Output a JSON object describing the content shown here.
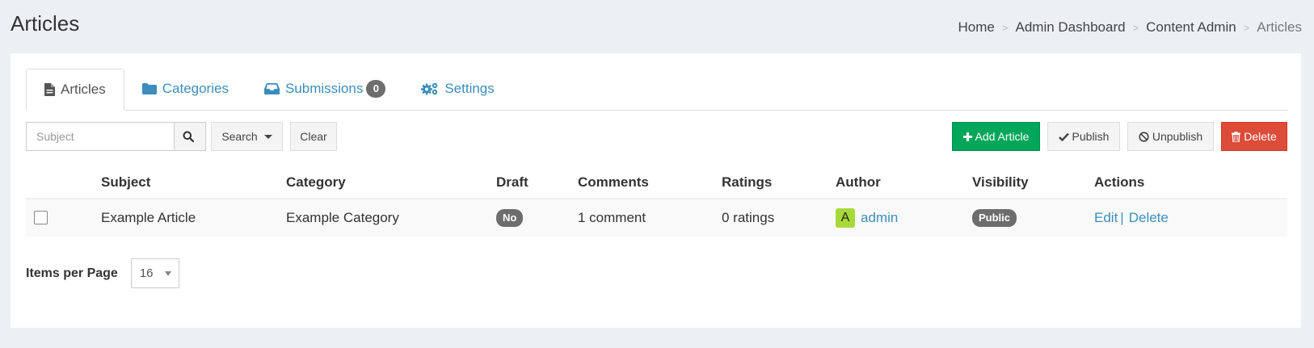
{
  "page": {
    "title": "Articles"
  },
  "breadcrumb": {
    "items": [
      "Home",
      "Admin Dashboard",
      "Content Admin",
      "Articles"
    ],
    "separator": ">"
  },
  "tabs": [
    {
      "label": "Articles",
      "icon": "file-icon",
      "active": true
    },
    {
      "label": "Categories",
      "icon": "folder-icon",
      "active": false
    },
    {
      "label": "Submissions",
      "icon": "inbox-icon",
      "active": false,
      "badge": "0"
    },
    {
      "label": "Settings",
      "icon": "gears-icon",
      "active": false
    }
  ],
  "toolbar": {
    "search_placeholder": "Subject",
    "search_dropdown_label": "Search",
    "clear_label": "Clear",
    "add_label": "Add Article",
    "publish_label": "Publish",
    "unpublish_label": "Unpublish",
    "delete_label": "Delete"
  },
  "table": {
    "headers": [
      "Subject",
      "Category",
      "Draft",
      "Comments",
      "Ratings",
      "Author",
      "Visibility",
      "Actions"
    ],
    "rows": [
      {
        "subject": "Example Article",
        "category": "Example Category",
        "draft": "No",
        "comments": "1 comment",
        "ratings": "0 ratings",
        "author_initial": "A",
        "author": "admin",
        "visibility": "Public",
        "edit_label": "Edit",
        "actions_separator": "|",
        "delete_label": "Delete"
      }
    ]
  },
  "pagination": {
    "items_per_page_label": "Items per Page",
    "items_per_page_value": "16"
  },
  "colors": {
    "link": "#3c8dbc",
    "success": "#00a65a",
    "danger": "#dd4b39",
    "badge": "#6d6d6d",
    "avatar": "#a7d93a",
    "background": "#ecf0f5"
  }
}
